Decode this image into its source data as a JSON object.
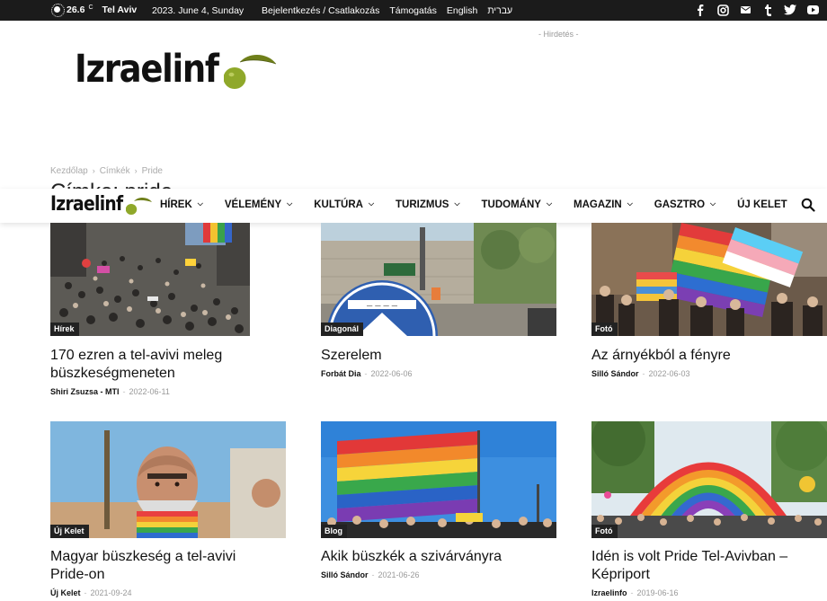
{
  "topbar": {
    "temperature": "26.6",
    "unit": "C",
    "city": "Tel Aviv",
    "date": "2023. June 4, Sunday",
    "links": [
      "Bejelentkezés / Csatlakozás",
      "Támogatás",
      "English",
      "עברית"
    ],
    "social_icons": [
      "facebook-icon",
      "instagram-icon",
      "mail-icon",
      "tumblr-icon",
      "twitter-icon",
      "youtube-icon"
    ]
  },
  "header": {
    "ad_label": "- Hirdetés -",
    "logo_text": "Izraelinf"
  },
  "breadcrumb": [
    "Kezdőlap",
    "Címkék",
    "Pride"
  ],
  "page_title": "Címke: pride",
  "nav": {
    "logo_text": "Izraelinf",
    "items": [
      "HÍREK",
      "VÉLEMÉNY",
      "KULTÚRA",
      "TURIZMUS",
      "TUDOMÁNY",
      "MAGAZIN",
      "GASZTRO",
      "ÚJ KELET"
    ],
    "has_dropdown": [
      true,
      true,
      true,
      true,
      true,
      true,
      true,
      false
    ]
  },
  "articles": [
    {
      "category": "Hírek",
      "title": "170 ezren a tel-avivi meleg büszkeségmeneten",
      "author": "Shiri Zsuzsa - MTI",
      "date": "2022-06-11"
    },
    {
      "category": "Diagonál",
      "title": "Szerelem",
      "author": "Forbát Dia",
      "date": "2022-06-06"
    },
    {
      "category": "Fotó",
      "title": "Az árnyékból a fényre",
      "author": "Silló Sándor",
      "date": "2022-06-03"
    },
    {
      "category": "Új Kelet",
      "title": "Magyar büszkeség a tel-avivi Pride-on",
      "author": "Új Kelet",
      "date": "2021-09-24"
    },
    {
      "category": "Blog",
      "title": "Akik büszkék a szivárványra",
      "author": "Silló Sándor",
      "date": "2021-06-26"
    },
    {
      "category": "Fotó",
      "title": "Idén is volt Pride Tel-Avivban – Képriport",
      "author": "Izraelinfo",
      "date": "2019-06-16"
    }
  ],
  "colors": {
    "topbar_bg": "#1b1b1b",
    "logo_olive": "#8fa82a",
    "logo_leaf": "#7a8a1e",
    "category_bg": "#222222"
  }
}
